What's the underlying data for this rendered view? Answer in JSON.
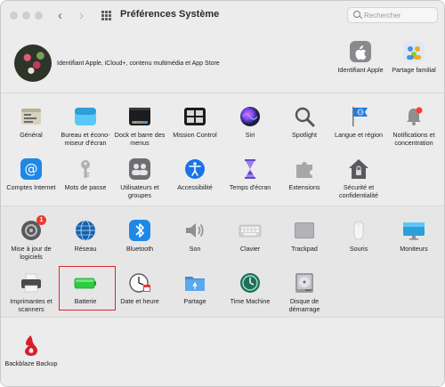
{
  "window": {
    "title": "Préférences Système",
    "search_placeholder": "Rechercher"
  },
  "account": {
    "label": "Identifiant Apple, iCloud+, contenu multimédia et App Store",
    "items": [
      {
        "label": "Identifiant Apple",
        "icon": "apple-logo-icon"
      },
      {
        "label": "Partage familial",
        "icon": "family-sharing-icon"
      }
    ]
  },
  "section1": [
    {
      "label": "Général",
      "icon": "general-icon"
    },
    {
      "label": "Bureau et écono-miseur d'écran",
      "icon": "desktop-screensaver-icon"
    },
    {
      "label": "Dock et barre des menus",
      "icon": "dock-menubar-icon"
    },
    {
      "label": "Mission Control",
      "icon": "mission-control-icon"
    },
    {
      "label": "Siri",
      "icon": "siri-icon"
    },
    {
      "label": "Spotlight",
      "icon": "spotlight-icon"
    },
    {
      "label": "Langue et région",
      "icon": "language-region-icon"
    },
    {
      "label": "Notifications et concentration",
      "icon": "notifications-icon"
    },
    {
      "label": "Comptes Internet",
      "icon": "internet-accounts-icon"
    },
    {
      "label": "Mots de passe",
      "icon": "passwords-icon"
    },
    {
      "label": "Utilisateurs et groupes",
      "icon": "users-groups-icon"
    },
    {
      "label": "Accessibilité",
      "icon": "accessibility-icon"
    },
    {
      "label": "Temps d'écran",
      "icon": "screen-time-icon"
    },
    {
      "label": "Extensions",
      "icon": "extensions-icon"
    },
    {
      "label": "Sécurité et confidentialité",
      "icon": "security-privacy-icon"
    }
  ],
  "section2": [
    {
      "label": "Mise à jour de logiciels",
      "icon": "software-update-icon",
      "badge": "1"
    },
    {
      "label": "Réseau",
      "icon": "network-icon"
    },
    {
      "label": "Bluetooth",
      "icon": "bluetooth-icon"
    },
    {
      "label": "Son",
      "icon": "sound-icon"
    },
    {
      "label": "Clavier",
      "icon": "keyboard-icon"
    },
    {
      "label": "Trackpad",
      "icon": "trackpad-icon"
    },
    {
      "label": "Souris",
      "icon": "mouse-icon"
    },
    {
      "label": "Moniteurs",
      "icon": "displays-icon"
    },
    {
      "label": "Imprimantes et scanners",
      "icon": "printers-scanners-icon"
    },
    {
      "label": "Batterie",
      "icon": "battery-icon"
    },
    {
      "label": "Date et heure",
      "icon": "date-time-icon"
    },
    {
      "label": "Partage",
      "icon": "sharing-icon"
    },
    {
      "label": "Time Machine",
      "icon": "time-machine-icon"
    },
    {
      "label": "Disque de démarrage",
      "icon": "startup-disk-icon"
    }
  ],
  "section3": [
    {
      "label": "Backblaze Backup",
      "icon": "backblaze-icon"
    }
  ]
}
